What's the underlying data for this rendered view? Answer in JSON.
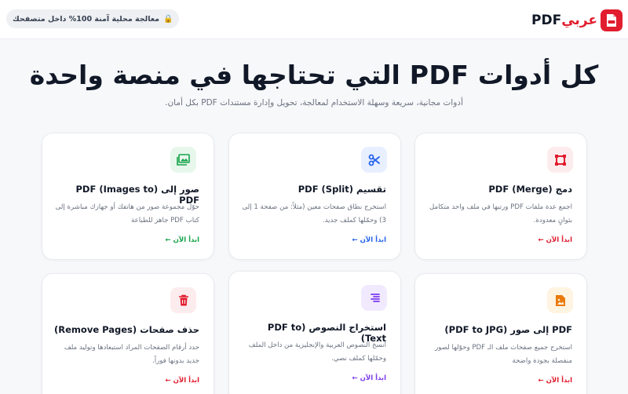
{
  "header": {
    "logo_pdf": "PDF",
    "logo_ar": "عربي",
    "privacy": "معالجة محلية آمنة 100% داخل متصفحك"
  },
  "hero": {
    "title": "كل أدوات PDF التي تحتاجها في منصة واحدة",
    "subtitle": "أدوات مجانية، سريعة وسهلة الاستخدام لمعالجة، تحويل وإدارة مستندات PDF بكل أمان."
  },
  "cta_label": "ابدأ الآن ←",
  "tools": [
    {
      "title": "دمج (PDF (Merge",
      "desc": "اجمع عدة ملفات PDF ورتبها في ملف واحد متكامل بثوانٍ معدودة.",
      "icon": "merge-icon",
      "color": "#e11d2e",
      "bg": "#fdecee"
    },
    {
      "title": "تقسيم (PDF (Split",
      "desc": "استخرج نطاق صفحات معين (مثلاً: من صفحة 1 إلى 3) وحمّلها كملف جديد.",
      "icon": "scissors-icon",
      "color": "#2563eb",
      "bg": "#e8efff"
    },
    {
      "title": "صور إلى (PDF (Images to PDF",
      "desc": "حوّل مجموعة صور من هاتفك أو جهازك مباشرة إلى كتاب PDF جاهز للطباعة",
      "icon": "image-icon",
      "color": "#16a34a",
      "bg": "#e7f7ec"
    },
    {
      "title": "PDF إلى صور (PDF to JPG)",
      "desc": "استخرج جميع صفحات ملف الـ PDF وحوّلها لصور منفصلة بجودة واضحة",
      "icon": "image-file-icon",
      "color": "#ea7a0c",
      "bg": "#fff3e2"
    },
    {
      "title": "استخراج النصوص (PDF to Text)",
      "desc": "انسخ النصوص العربية والإنجليزية من داخل الملف وحمّلها كملف نصي.",
      "icon": "text-lines-icon",
      "color": "#7c3aed",
      "bg": "#f1eafe"
    },
    {
      "title": "حذف صفحات (Remove Pages)",
      "desc": "حدد أرقام الصفحات المراد استبعادها وتوليد ملف جديد بدونها فوراً.",
      "icon": "trash-icon",
      "color": "#e11d2e",
      "bg": "#fdecee"
    }
  ]
}
